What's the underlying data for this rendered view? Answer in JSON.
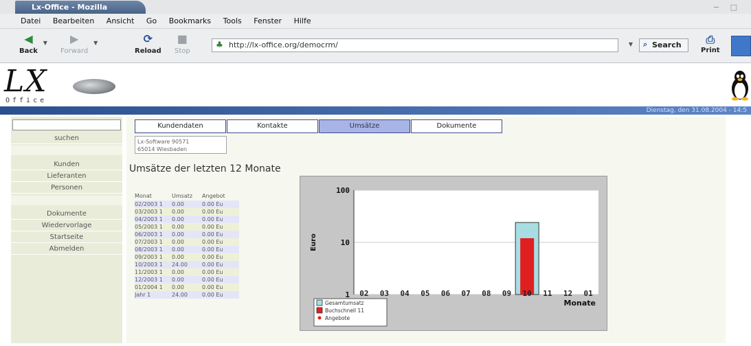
{
  "browser": {
    "window_title": "Lx-Office - Mozilla",
    "menu": [
      "Datei",
      "Bearbeiten",
      "Ansicht",
      "Go",
      "Bookmarks",
      "Tools",
      "Fenster",
      "Hilfe"
    ],
    "nav": {
      "back": "Back",
      "forward": "Forward",
      "reload": "Reload",
      "stop": "Stop"
    },
    "url": "http://lx-office.org/democrm/",
    "search_label": "Search",
    "print_label": "Print"
  },
  "app": {
    "logo_text": "LX",
    "logo_sub": "Office",
    "status_text": "Dienstag, den 31.08.2004 - 14:5"
  },
  "left_menu": {
    "search_button": "suchen",
    "items": [
      "Kunden",
      "Lieferanten",
      "Personen",
      "Dokumente",
      "Wiedervorlage",
      "Startseite",
      "Abmelden"
    ]
  },
  "tabs": [
    {
      "label": "Kundendaten"
    },
    {
      "label": "Kontakte"
    },
    {
      "label": "Umsätze"
    },
    {
      "label": "Dokumente"
    }
  ],
  "active_tab": "Umsätze",
  "customer": {
    "line1": "Lx-Software     90571",
    "line2": "65014 Wiesbaden"
  },
  "page_title": "Umsätze der letzten 12 Monate",
  "sales_table": {
    "headers": [
      "Monat",
      "Umsatz",
      "Angebot"
    ],
    "rows": [
      [
        "02/2003 1",
        "0.00",
        "0.00 Eu"
      ],
      [
        "03/2003 1",
        "0.00",
        "0.00 Eu"
      ],
      [
        "04/2003 1",
        "0.00",
        "0.00 Eu"
      ],
      [
        "05/2003 1",
        "0.00",
        "0.00 Eu"
      ],
      [
        "06/2003 1",
        "0.00",
        "0.00 Eu"
      ],
      [
        "07/2003 1",
        "0.00",
        "0.00 Eu"
      ],
      [
        "08/2003 1",
        "0.00",
        "0.00 Eu"
      ],
      [
        "09/2003 1",
        "0.00",
        "0.00 Eu"
      ],
      [
        "10/2003 1",
        "24.00",
        "0.00 Eu"
      ],
      [
        "11/2003 1",
        "0.00",
        "0.00 Eu"
      ],
      [
        "12/2003 1",
        "0.00",
        "0.00 Eu"
      ],
      [
        "01/2004 1",
        "0.00",
        "0.00 Eu"
      ],
      [
        "Jahr 1",
        "24.00",
        "0.00 Eu"
      ]
    ]
  },
  "chart_data": {
    "type": "bar",
    "scale": "log",
    "ylabel": "Euro",
    "xlabel": "Monate",
    "ylim": [
      1,
      100
    ],
    "yticks": [
      "1",
      "10",
      "100"
    ],
    "categories": [
      "02",
      "03",
      "04",
      "05",
      "06",
      "07",
      "08",
      "09",
      "10",
      "11",
      "12",
      "01"
    ],
    "grid": true,
    "legend_position": "bottom-left",
    "series": [
      {
        "name": "Gesamtumsatz",
        "color": "#a9dde4",
        "values": [
          0,
          0,
          0,
          0,
          0,
          0,
          0,
          0,
          24,
          0,
          0,
          0
        ]
      },
      {
        "name": "Buchschnell 11",
        "color": "#e02020",
        "values": [
          0,
          0,
          0,
          0,
          0,
          0,
          0,
          0,
          12,
          0,
          0,
          0
        ]
      },
      {
        "name": "Angebote",
        "color": "#e02020",
        "values": [
          0,
          0,
          0,
          0,
          0,
          0,
          0,
          0,
          0,
          0,
          0,
          0
        ]
      }
    ]
  }
}
